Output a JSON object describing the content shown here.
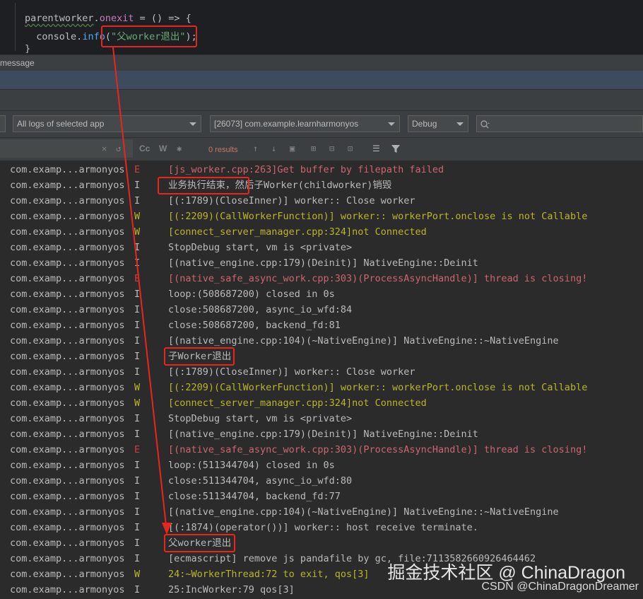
{
  "editor": {
    "line1": {
      "obj": "parentworker",
      "dot": ".",
      "prop": "onexit",
      "rest": " = () => {"
    },
    "line2": {
      "indent": "  ",
      "obj": "console",
      "dot": ".",
      "fn": "info",
      "open": "(",
      "str": "\"父worker退出\"",
      "close": ");"
    },
    "line3": {
      "text": "}"
    }
  },
  "tool_window": {
    "title": "message"
  },
  "filters": {
    "device_combo": "",
    "log_scope": "All logs of selected app",
    "process": "[26073] com.example.learnharmonyos",
    "level": "Debug",
    "search_placeholder": ""
  },
  "toolbar": {
    "cc": "Cc",
    "w": "W",
    "results": "0 results"
  },
  "colors": {
    "info": "#bbbbbb",
    "warn": "#bbb529",
    "error": "#cc666e",
    "error_level": "#cc3e44",
    "highlight": "#e8261d"
  },
  "logs": [
    {
      "tag": "com.examp...armonyos",
      "level": "E",
      "msg": "[js_worker.cpp:263]Get buffer by filepath failed",
      "kind": "error"
    },
    {
      "tag": "com.examp...armonyos",
      "level": "I",
      "msg": "业务执行结束，然后子Worker(childworker)销毁",
      "kind": "info"
    },
    {
      "tag": "com.examp...armonyos",
      "level": "I",
      "msg": "[(:1789)(CloseInner)] worker:: Close worker",
      "kind": "info"
    },
    {
      "tag": "com.examp...armonyos",
      "level": "W",
      "msg": "[(:2209)(CallWorkerFunction)] worker:: workerPort.onclose is not Callable",
      "kind": "warn"
    },
    {
      "tag": "com.examp...armonyos",
      "level": "W",
      "msg": "[connect_server_manager.cpp:324]not Connected",
      "kind": "warn"
    },
    {
      "tag": "com.examp...armonyos",
      "level": "I",
      "msg": "StopDebug start, vm is <private>",
      "kind": "info"
    },
    {
      "tag": "com.examp...armonyos",
      "level": "I",
      "msg": "[(native_engine.cpp:179)(Deinit)] NativeEngine::Deinit",
      "kind": "info"
    },
    {
      "tag": "com.examp...armonyos",
      "level": "E",
      "msg": "[(native_safe_async_work.cpp:303)(ProcessAsyncHandle)] thread is closing!",
      "kind": "error"
    },
    {
      "tag": "com.examp...armonyos",
      "level": "I",
      "msg": "loop:(508687200) closed in 0s",
      "kind": "info"
    },
    {
      "tag": "com.examp...armonyos",
      "level": "I",
      "msg": "close:508687200, async_io_wfd:84",
      "kind": "info"
    },
    {
      "tag": "com.examp...armonyos",
      "level": "I",
      "msg": "close:508687200, backend_fd:81",
      "kind": "info"
    },
    {
      "tag": "com.examp...armonyos",
      "level": "I",
      "msg": "[(native_engine.cpp:104)(~NativeEngine)] NativeEngine::~NativeEngine",
      "kind": "info"
    },
    {
      "tag": "com.examp...armonyos",
      "level": "I",
      "msg": "子Worker退出",
      "kind": "info"
    },
    {
      "tag": "com.examp...armonyos",
      "level": "I",
      "msg": "[(:1789)(CloseInner)] worker:: Close worker",
      "kind": "info"
    },
    {
      "tag": "com.examp...armonyos",
      "level": "W",
      "msg": "[(:2209)(CallWorkerFunction)] worker:: workerPort.onclose is not Callable",
      "kind": "warn"
    },
    {
      "tag": "com.examp...armonyos",
      "level": "W",
      "msg": "[connect_server_manager.cpp:324]not Connected",
      "kind": "warn"
    },
    {
      "tag": "com.examp...armonyos",
      "level": "I",
      "msg": "StopDebug start, vm is <private>",
      "kind": "info"
    },
    {
      "tag": "com.examp...armonyos",
      "level": "I",
      "msg": "[(native_engine.cpp:179)(Deinit)] NativeEngine::Deinit",
      "kind": "info"
    },
    {
      "tag": "com.examp...armonyos",
      "level": "E",
      "msg": "[(native_safe_async_work.cpp:303)(ProcessAsyncHandle)] thread is closing!",
      "kind": "error"
    },
    {
      "tag": "com.examp...armonyos",
      "level": "I",
      "msg": "loop:(511344704) closed in 0s",
      "kind": "info"
    },
    {
      "tag": "com.examp...armonyos",
      "level": "I",
      "msg": "close:511344704, async_io_wfd:80",
      "kind": "info"
    },
    {
      "tag": "com.examp...armonyos",
      "level": "I",
      "msg": "close:511344704, backend_fd:77",
      "kind": "info"
    },
    {
      "tag": "com.examp...armonyos",
      "level": "I",
      "msg": "[(native_engine.cpp:104)(~NativeEngine)] NativeEngine::~NativeEngine",
      "kind": "info"
    },
    {
      "tag": "com.examp...armonyos",
      "level": "I",
      "msg": "[(:1874)(operator())] worker:: host receive terminate.",
      "kind": "info"
    },
    {
      "tag": "com.examp...armonyos",
      "level": "I",
      "msg": "父worker退出",
      "kind": "info"
    },
    {
      "tag": "com.examp...armonyos",
      "level": "I",
      "msg": "[ecmascript] remove js pandafile by gc, file:7113582660926464462",
      "kind": "info"
    },
    {
      "tag": "com.examp...armonyos",
      "level": "W",
      "msg": "24:~WorkerThread:72 to exit, qos[3]",
      "kind": "warn"
    },
    {
      "tag": "com.examp...armonyos",
      "level": "I",
      "msg": "25:IncWorker:79 qos[3]",
      "kind": "info"
    }
  ],
  "watermark": {
    "line1": "掘金技术社区 @ ChinaDragon",
    "line2": "CSDN @ChinaDragonDreamer"
  }
}
